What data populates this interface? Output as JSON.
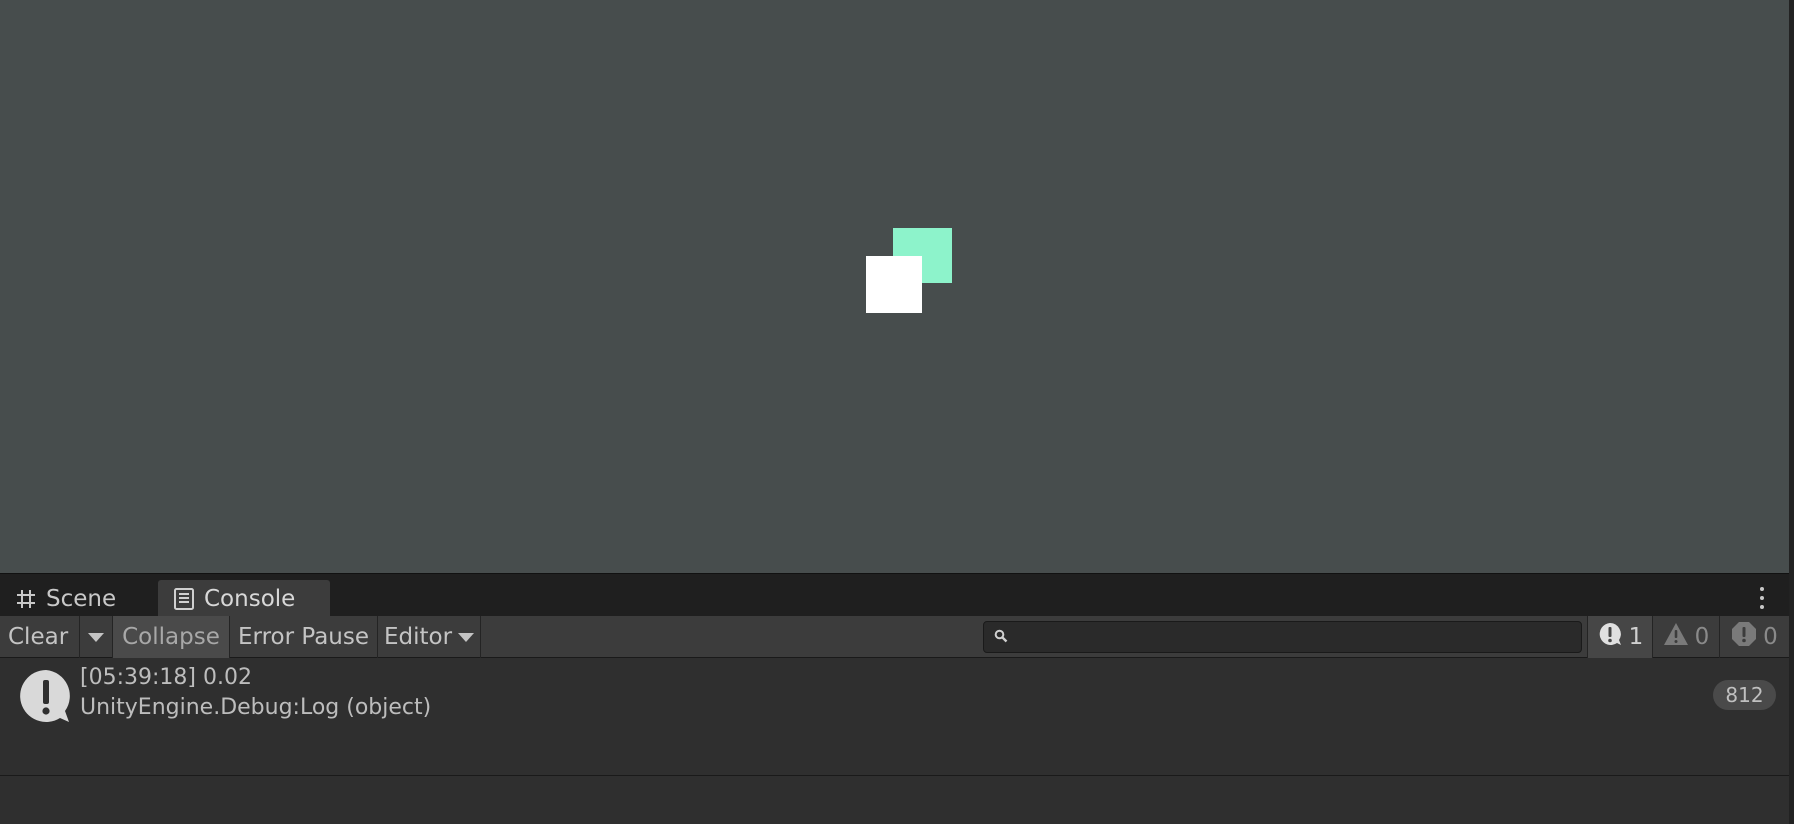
{
  "tabs": [
    {
      "label": "Scene",
      "icon": "grid-icon"
    },
    {
      "label": "Console",
      "icon": "console-icon"
    }
  ],
  "toolbar": {
    "clear_label": "Clear",
    "collapse_label": "Collapse",
    "error_pause_label": "Error Pause",
    "editor_label": "Editor",
    "search_placeholder": ""
  },
  "counters": {
    "info": "1",
    "warnings": "0",
    "errors": "0"
  },
  "log": [
    {
      "line1": "[05:39:18] 0.02",
      "line2": "UnityEngine.Debug:Log (object)",
      "count": "812"
    }
  ],
  "colors": {
    "game_background": "#474d4d",
    "sprite_mint": "#8df3cb",
    "sprite_white": "#ffffff"
  }
}
